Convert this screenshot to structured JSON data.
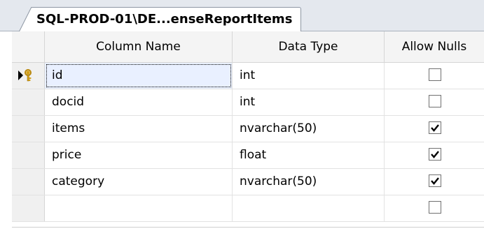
{
  "tab": {
    "title": "SQL-PROD-01\\DE...enseReportItems"
  },
  "columns_header": {
    "name": "Column Name",
    "type": "Data Type",
    "nulls": "Allow Nulls"
  },
  "rows": [
    {
      "name": "id",
      "type": "int",
      "allow_nulls": false,
      "primary_key": true
    },
    {
      "name": "docid",
      "type": "int",
      "allow_nulls": false
    },
    {
      "name": "items",
      "type": "nvarchar(50)",
      "allow_nulls": true
    },
    {
      "name": "price",
      "type": "float",
      "allow_nulls": true
    },
    {
      "name": "category",
      "type": "nvarchar(50)",
      "allow_nulls": true
    },
    {
      "name": "",
      "type": "",
      "allow_nulls": false
    }
  ],
  "icons": {
    "row_indicator": "current-row-primary-key-icon"
  },
  "colors": {
    "key": "#d4a017",
    "selection": "#e9f0ff"
  }
}
